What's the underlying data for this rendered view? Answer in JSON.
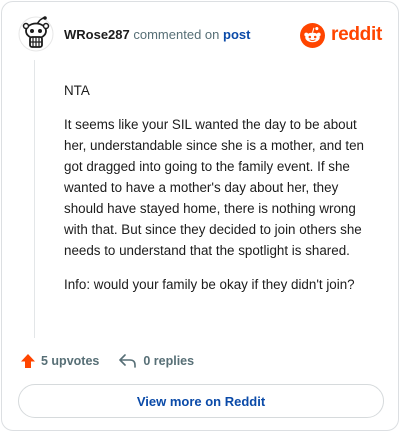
{
  "header": {
    "username": "WRose287",
    "action_text": "commented on",
    "post_link": "post",
    "brand": "reddit"
  },
  "comment": {
    "paragraphs": [
      "NTA",
      "It seems like your SIL wanted the day to be about her, understandable since she is a mother, and ten got dragged into going to the family event. If she wanted to have a mother's day about her, they should have stayed home, there is nothing wrong with that. But since they decided to join others she needs to understand that the spotlight is shared.",
      "Info: would your family be okay if they didn't join?"
    ]
  },
  "actions": {
    "upvotes": "5 upvotes",
    "replies": "0 replies"
  },
  "footer": {
    "view_more": "View more on Reddit"
  },
  "colors": {
    "brand": "#ff4500",
    "link": "#0a4aa8",
    "muted": "#576f76"
  },
  "icons": {
    "avatar": "snoo-avatar",
    "brand_logo": "reddit-logo-icon",
    "upvote": "upvote-arrow-icon",
    "reply": "reply-arrow-icon"
  }
}
